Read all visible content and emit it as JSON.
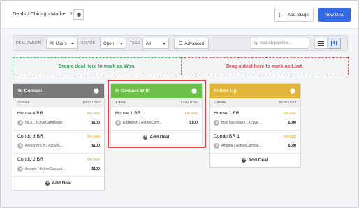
{
  "header": {
    "breadcrumb_root": "Deals",
    "breadcrumb_sep": "/",
    "pipeline_name": "Chicago Market",
    "add_stage_label": "Add Stage",
    "new_deal_label": "New Deal"
  },
  "filters": {
    "deal_owner_label": "DEAL OWNER",
    "deal_owner_value": "All Users",
    "status_label": "STATUS",
    "status_value": "Open",
    "tags_label": "TAGS",
    "tags_value": "All",
    "advanced_label": "Advanced",
    "search_placeholder": "Search pipeline..."
  },
  "dropzones": {
    "won": "Drag a deal here to mark as Won.",
    "lost": "Drag a deal here to mark as Lost."
  },
  "columns": [
    {
      "title": "To Contact",
      "color": "#7a7a7a",
      "count": "3 deals",
      "total": "$300 USD",
      "deals": [
        {
          "title": "House 4 BR",
          "task": "No task",
          "person": "Nick / ActiveCampaign",
          "amount": "$100"
        },
        {
          "title": "Condo 3 BR",
          "task": "No task",
          "person": "Alexandra B / ActiveC...",
          "amount": "$100"
        },
        {
          "title": "Condo 2 BR",
          "task": "No task",
          "person": "Angela / ActiveCampai...",
          "amount": "$100"
        }
      ],
      "add_label": "Add Deal"
    },
    {
      "title": "In Contact With",
      "color": "#6cc04a",
      "count": "1 deal",
      "total": "$100 USD",
      "deals": [
        {
          "title": "House 1 BR",
          "task": "No task",
          "person": "Elizabeth / ActiveCam...",
          "amount": "$100"
        }
      ],
      "add_label": "Add Deal"
    },
    {
      "title": "Follow Up",
      "color": "#e2b43a",
      "count": "2 deals",
      "total": "$200 USD",
      "deals": [
        {
          "title": "House 1 BR",
          "task": "No task",
          "person": "Bob Nicholaev / Active...",
          "amount": "$100"
        },
        {
          "title": "Condo BR 1",
          "task": "No task",
          "person": "Angela / ActiveCampai...",
          "amount": "$100"
        }
      ],
      "add_label": "Add Deal"
    }
  ]
}
